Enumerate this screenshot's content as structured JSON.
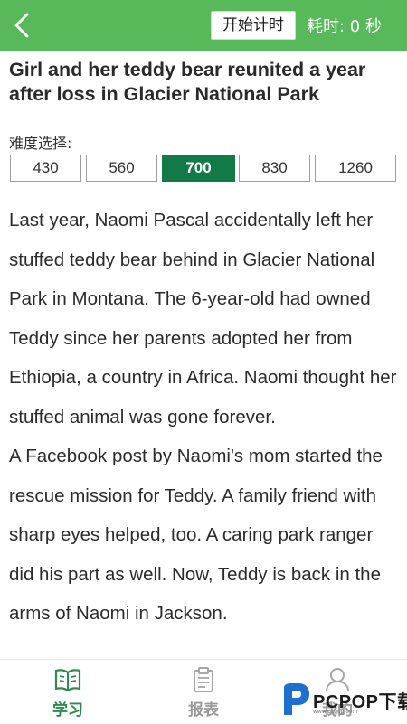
{
  "header": {
    "start_label": "开始计时",
    "timer_text": "耗时: 0 秒"
  },
  "article": {
    "title": "Girl and her teddy bear reunited a year after loss in Glacier National Park",
    "paragraphs": [
      "Last year, Naomi Pascal accidentally left her stuffed teddy bear behind in Glacier National Park in Montana. The 6-year-old had owned Teddy since her parents adopted her from Ethiopia, a country in Africa. Naomi thought her stuffed animal was gone forever.",
      "A Facebook post by Naomi's mom started the rescue mission for Teddy. A family friend with sharp eyes helped, too. A caring park ranger did his part as well. Now, Teddy is back in the arms of Naomi in Jackson."
    ]
  },
  "difficulty": {
    "label": "难度选择:",
    "options": [
      "430",
      "560",
      "700",
      "830",
      "1260"
    ],
    "selected": "700"
  },
  "tabs": [
    {
      "label": "学习",
      "icon": "book-icon",
      "active": true
    },
    {
      "label": "报表",
      "icon": "clipboard-icon",
      "active": false
    },
    {
      "label": "我的",
      "icon": "user-icon",
      "active": false
    }
  ],
  "watermark": {
    "brand": "PCPOP下载",
    "url": "www.pcpop.com"
  },
  "colors": {
    "topbar": "#58b95a",
    "selected": "#127a47",
    "active_tab": "#2e8a4f"
  }
}
